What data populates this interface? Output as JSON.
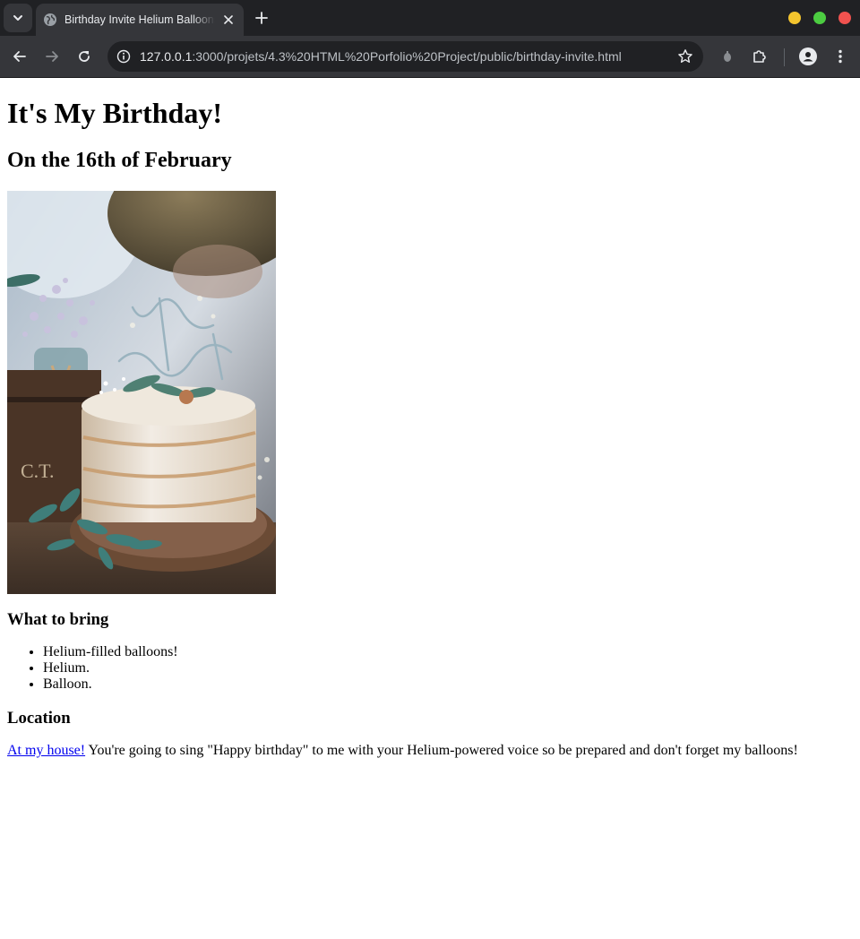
{
  "browser": {
    "tab_title": "Birthday Invite Helium Balloons",
    "url_host": "127.0.0.1",
    "url_rest": ":3000/projets/4.3%20HTML%20Porfolio%20Project/public/birthday-invite.html"
  },
  "page": {
    "title": "It's My Birthday!",
    "date_heading": "On the 16th of February",
    "image_alt": "Happy Birthday cake",
    "bring_heading": "What to bring",
    "bring_items": [
      "Helium-filled balloons!",
      "Helium.",
      "Balloon."
    ],
    "location_heading": "Location",
    "location_link": "At my house!",
    "location_text": " You're going to sing \"Happy birthday\" to me with your Helium-powered voice so be prepared and don't forget my balloons!"
  },
  "icons": {
    "tab_search": "chevron-down-icon",
    "favicon": "globe-icon",
    "close": "close-icon",
    "new_tab": "plus-icon",
    "back": "arrow-left-icon",
    "forward": "arrow-right-icon",
    "reload": "reload-icon",
    "site_info": "info-icon",
    "bookmark": "star-icon",
    "extension_pin": "pin-icon",
    "extensions": "puzzle-icon",
    "profile": "profile-icon",
    "menu": "kebab-menu-icon"
  },
  "colors": {
    "chrome_dark": "#202124",
    "chrome_toolbar": "#35363a",
    "link": "#0000ee",
    "traffic_yellow": "#f3c42e",
    "traffic_green": "#4ccc41",
    "traffic_red": "#f0524f"
  }
}
